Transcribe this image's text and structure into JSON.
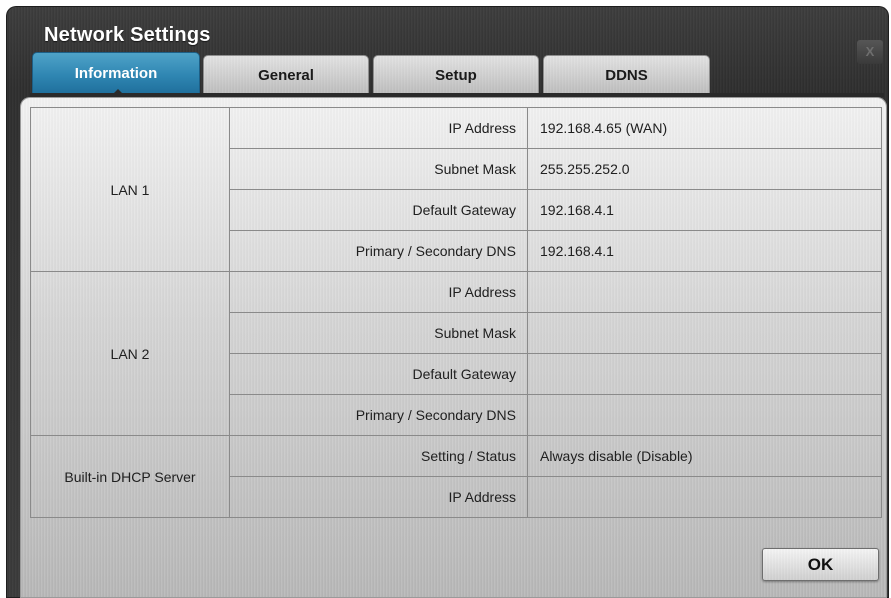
{
  "window": {
    "title": "Network Settings",
    "close_label": "X"
  },
  "tabs": [
    {
      "label": "Information",
      "active": true
    },
    {
      "label": "General",
      "active": false
    },
    {
      "label": "Setup",
      "active": false
    },
    {
      "label": "DDNS",
      "active": false
    }
  ],
  "info_table": {
    "lan1": {
      "group": "LAN 1",
      "rows": [
        {
          "label": "IP Address",
          "value": "192.168.4.65 (WAN)"
        },
        {
          "label": "Subnet Mask",
          "value": "255.255.252.0"
        },
        {
          "label": "Default Gateway",
          "value": "192.168.4.1"
        },
        {
          "label": "Primary / Secondary DNS",
          "value": "192.168.4.1"
        }
      ]
    },
    "lan2": {
      "group": "LAN 2",
      "rows": [
        {
          "label": "IP Address",
          "value": ""
        },
        {
          "label": "Subnet Mask",
          "value": ""
        },
        {
          "label": "Default Gateway",
          "value": ""
        },
        {
          "label": "Primary / Secondary DNS",
          "value": ""
        }
      ]
    },
    "dhcp": {
      "group": "Built-in DHCP Server",
      "rows": [
        {
          "label": "Setting / Status",
          "value": "Always disable (Disable)"
        },
        {
          "label": "IP Address",
          "value": ""
        }
      ]
    }
  },
  "footer": {
    "ok_label": "OK"
  },
  "colors": {
    "active_tab": "#2f86b2",
    "window_background": "#333333",
    "panel_background": "#d4d4d4"
  }
}
